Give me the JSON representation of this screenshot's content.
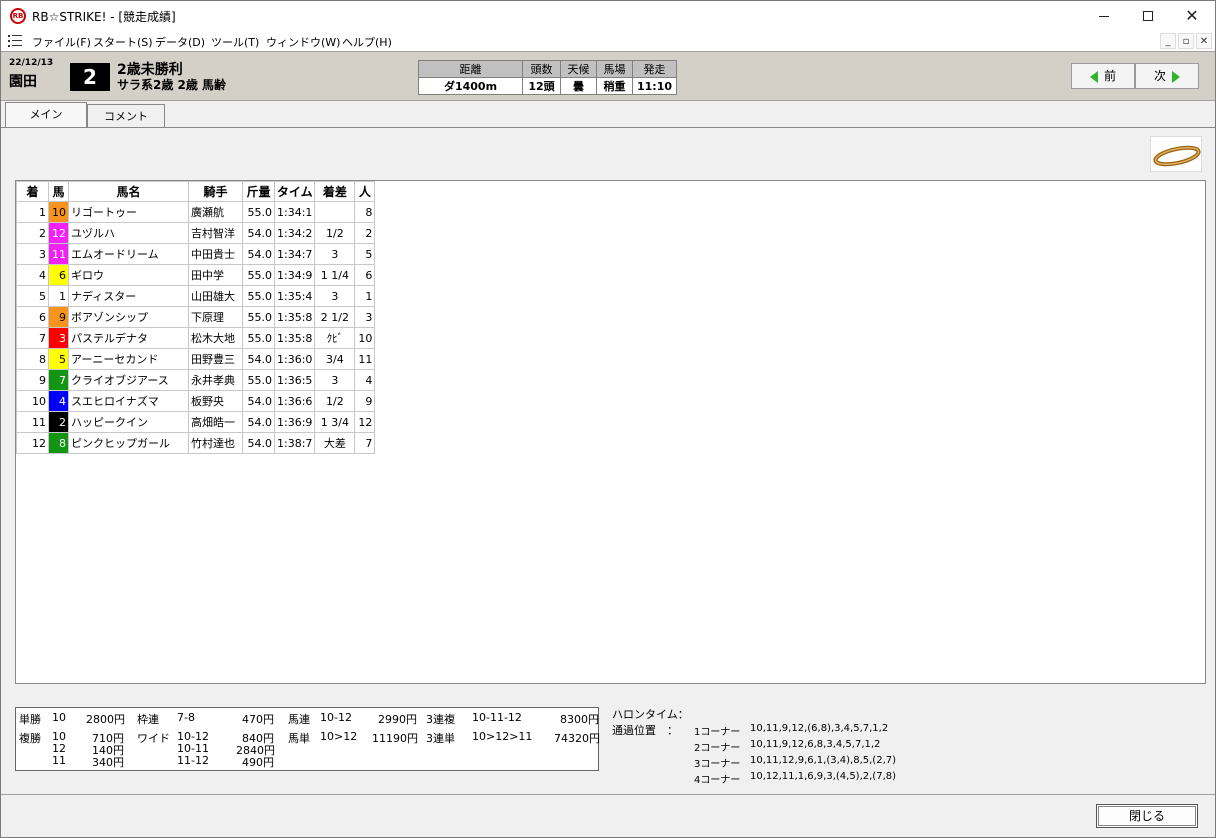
{
  "window": {
    "title": "RB☆STRIKE! - [競走成績]",
    "app_icon_text": "RB"
  },
  "menu": {
    "items": [
      "ファイル(F)",
      "スタート(S)",
      "データ(D)",
      "ツール(T)",
      "ウィンドウ(W)",
      "ヘルプ(H)"
    ]
  },
  "header": {
    "date": "22/12/13",
    "venue": "園田",
    "race_number": "2",
    "race_name": "2歳未勝利",
    "race_class": "サラ系2歳 2歳 馬齢",
    "conditions": {
      "labels": [
        "距離",
        "頭数",
        "天候",
        "馬場",
        "発走"
      ],
      "values": [
        "ダ1400m",
        "12頭",
        "曇",
        "稍重",
        "11:10"
      ]
    },
    "prev_label": "前",
    "next_label": "次"
  },
  "tabs": [
    "メイン",
    "コメント"
  ],
  "results": {
    "columns": [
      "着",
      "馬",
      "馬名",
      "騎手",
      "斤量",
      "タイム",
      "着差",
      "人"
    ],
    "rows": [
      {
        "rank": "1",
        "num": "10",
        "color": "#f7941d",
        "textcolor": "#000000",
        "name": "リゴートゥー",
        "jockey": "廣瀬航",
        "weight": "55.0",
        "time": "1:34:1",
        "margin": "",
        "pop": "8"
      },
      {
        "rank": "2",
        "num": "12",
        "color": "#f221f5",
        "textcolor": "#ffffff",
        "name": "ユヅルハ",
        "jockey": "吉村智洋",
        "weight": "54.0",
        "time": "1:34:2",
        "margin": "1/2",
        "pop": "2"
      },
      {
        "rank": "3",
        "num": "11",
        "color": "#f221f5",
        "textcolor": "#ffffff",
        "name": "エムオードリーム",
        "jockey": "中田貴士",
        "weight": "54.0",
        "time": "1:34:7",
        "margin": "3",
        "pop": "5"
      },
      {
        "rank": "4",
        "num": "6",
        "color": "#ffff00",
        "textcolor": "#000000",
        "name": "ギロウ",
        "jockey": "田中学",
        "weight": "55.0",
        "time": "1:34:9",
        "margin": "1 1/4",
        "pop": "6"
      },
      {
        "rank": "5",
        "num": "1",
        "color": "#ffffff",
        "textcolor": "#000000",
        "name": "ナディスター",
        "jockey": "山田雄大",
        "weight": "55.0",
        "time": "1:35:4",
        "margin": "3",
        "pop": "1"
      },
      {
        "rank": "6",
        "num": "9",
        "color": "#f7941d",
        "textcolor": "#000000",
        "name": "ボアゾンシップ",
        "jockey": "下原理",
        "weight": "55.0",
        "time": "1:35:8",
        "margin": "2 1/2",
        "pop": "3"
      },
      {
        "rank": "7",
        "num": "3",
        "color": "#ff0000",
        "textcolor": "#ffffff",
        "name": "パステルデナタ",
        "jockey": "松木大地",
        "weight": "55.0",
        "time": "1:35:8",
        "margin": "ｸﾋﾞ",
        "pop": "10"
      },
      {
        "rank": "8",
        "num": "5",
        "color": "#ffff00",
        "textcolor": "#000000",
        "name": "アーニーセカンド",
        "jockey": "田野豊三",
        "weight": "54.0",
        "time": "1:36:0",
        "margin": "3/4",
        "pop": "11"
      },
      {
        "rank": "9",
        "num": "7",
        "color": "#129512",
        "textcolor": "#ffffff",
        "name": "クライオブジアース",
        "jockey": "永井孝典",
        "weight": "55.0",
        "time": "1:36:5",
        "margin": "3",
        "pop": "4"
      },
      {
        "rank": "10",
        "num": "4",
        "color": "#0000ff",
        "textcolor": "#ffffff",
        "name": "スエヒロイナズマ",
        "jockey": "板野央",
        "weight": "54.0",
        "time": "1:36:6",
        "margin": "1/2",
        "pop": "9"
      },
      {
        "rank": "11",
        "num": "2",
        "color": "#000000",
        "textcolor": "#ffffff",
        "name": "ハッピークイン",
        "jockey": "高畑皓一",
        "weight": "54.0",
        "time": "1:36:9",
        "margin": "1 3/4",
        "pop": "12"
      },
      {
        "rank": "12",
        "num": "8",
        "color": "#129512",
        "textcolor": "#ffffff",
        "name": "ピンクヒップガール",
        "jockey": "竹村達也",
        "weight": "54.0",
        "time": "1:38:7",
        "margin": "大差",
        "pop": "7"
      }
    ]
  },
  "payout": {
    "tansho_label": "単勝",
    "tansho_num": "10",
    "tansho_amt": "2800円",
    "wakuren_label": "枠連",
    "wakuren_num": "7-8",
    "wakuren_amt": "470円",
    "umaren_label": "馬連",
    "umaren_num": "10-12",
    "umaren_amt": "2990円",
    "sanrenpuku_label": "3連複",
    "sanrenpuku_num": "10-11-12",
    "sanrenpuku_amt": "8300円",
    "fukusho_label": "複勝",
    "fukusho": [
      {
        "num": "10",
        "amt": "710円"
      },
      {
        "num": "12",
        "amt": "140円"
      },
      {
        "num": "11",
        "amt": "340円"
      }
    ],
    "wide_label": "ワイド",
    "wide": [
      {
        "num": "10-12",
        "amt": "840円"
      },
      {
        "num": "10-11",
        "amt": "2840円"
      },
      {
        "num": "11-12",
        "amt": "490円"
      }
    ],
    "umatan_label": "馬単",
    "umatan_num": "10>12",
    "umatan_amt": "11190円",
    "sanrentan_label": "3連単",
    "sanrentan_num": "10>12>11",
    "sanrentan_amt": "74320円"
  },
  "lap": {
    "furlong_label": "ハロンタイム：",
    "position_label": "通過位置　：",
    "corners": [
      {
        "label": "1コーナー",
        "order": "10,11,9,12,(6,8),3,4,5,7,1,2"
      },
      {
        "label": "2コーナー",
        "order": "10,11,9,12,6,8,3,4,5,7,1,2"
      },
      {
        "label": "3コーナー",
        "order": "10,11,12,9,6,1,(3,4),8,5,(2,7)"
      },
      {
        "label": "4コーナー",
        "order": "10,12,11,1,6,9,3,(4,5),2,(7,8)"
      }
    ]
  },
  "footer": {
    "close_label": "閉じる"
  }
}
